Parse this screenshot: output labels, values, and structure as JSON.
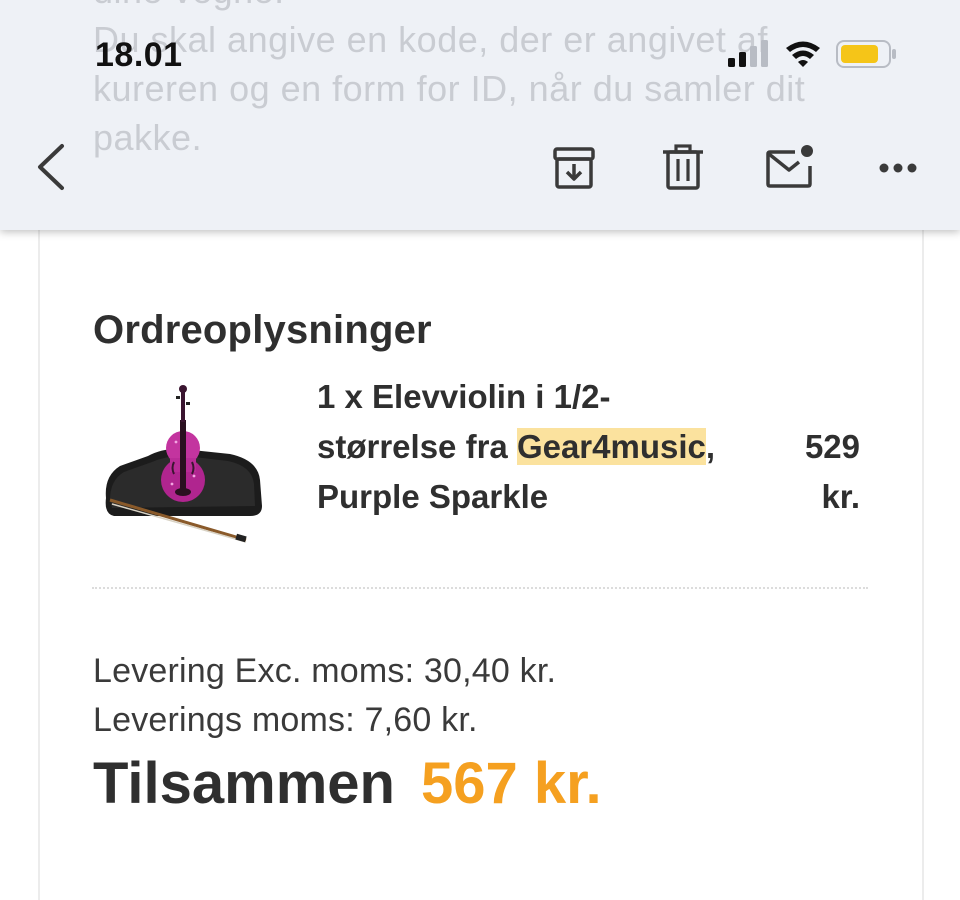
{
  "status_bar": {
    "time": "18.01",
    "battery_color": "#f5c518"
  },
  "background_text": {
    "lines": [
      "dine vegne.",
      "Du skal angive en kode, der er angivet af",
      "kureren og en form for ID, når du samler dit",
      "pakke."
    ]
  },
  "toolbar": {
    "back_icon": "chevron-left-icon",
    "archive_icon": "archive-icon",
    "delete_icon": "trash-icon",
    "mark_unread_icon": "mail-unread-icon",
    "more_icon": "more-horizontal-icon"
  },
  "order": {
    "section_title": "Ordreoplysninger",
    "item": {
      "name_part1": "1 x Elevviolin i 1/2-størrelse fra ",
      "highlighted_brand": "Gear4music",
      "name_part2": ", Purple Sparkle",
      "price_line1": "529",
      "price_line2": "kr."
    },
    "shipping_ex_vat": "Levering Exc. moms: 30,40 kr.",
    "shipping_vat": "Leverings moms: 7,60 kr.",
    "total_label": "Tilsammen",
    "total_amount": "567 kr.",
    "accent_color": "#f5a020"
  }
}
